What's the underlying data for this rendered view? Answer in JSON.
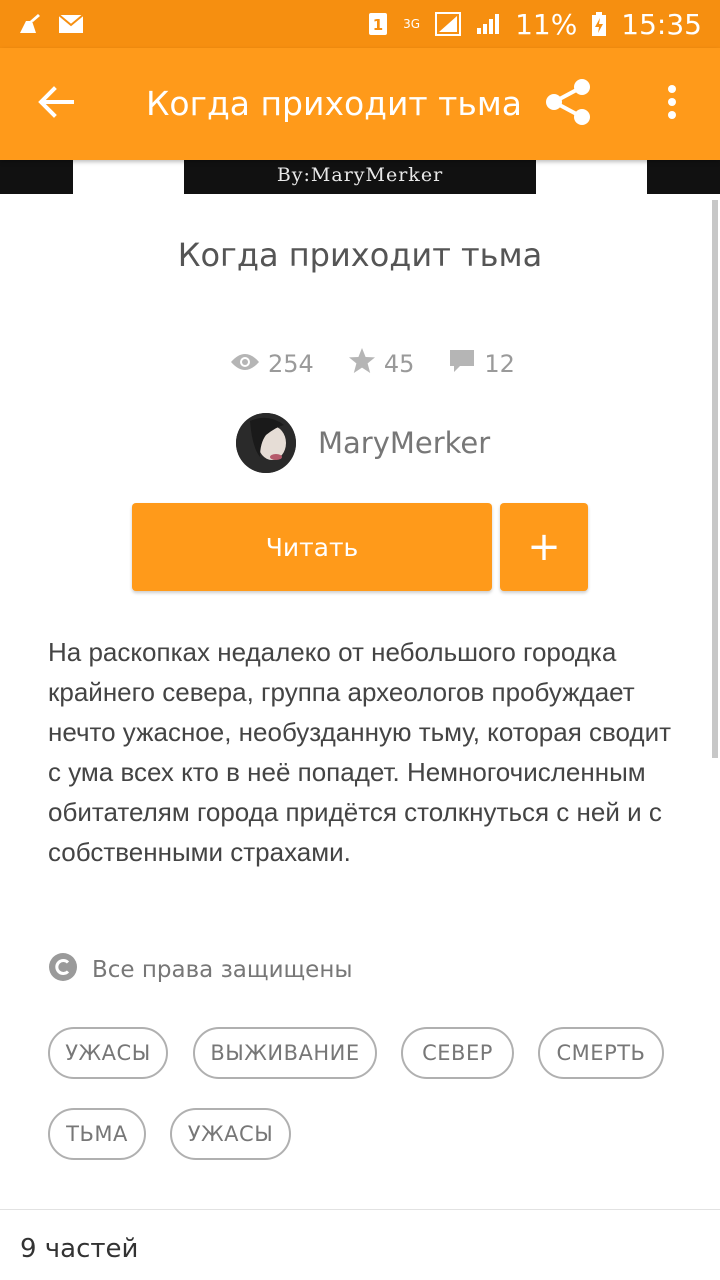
{
  "statusbar": {
    "sim_badge": "1",
    "network_type": "3G",
    "battery_percent": "11%",
    "time": "15:35"
  },
  "toolbar": {
    "title": "Когда приходит тьма"
  },
  "cover": {
    "credit": "By:MaryMerker"
  },
  "story": {
    "title": "Когда приходит тьма",
    "views": "254",
    "votes": "45",
    "comments": "12",
    "author": "MaryMerker",
    "read_label": "Читать",
    "add_label": "+",
    "description": "На раскопках недалеко от небольшого городка крайнего севера, группа археологов пробуждает нечто ужасное, необузданную тьму, которая сводит с ума всех кто в неё попадет. Немногочисленным обитателям города придётся столкнуться с ней и с собственными страхами.",
    "copyright": "Все права защищены",
    "tags": [
      "УЖАСЫ",
      "ВЫЖИВАНИЕ",
      "СЕВЕР",
      "СМЕРТЬ",
      "ТЬМА",
      "УЖАСЫ"
    ],
    "parts": "9 частей"
  },
  "colors": {
    "accent": "#ff9a1a",
    "statusbar": "#f68f10"
  }
}
